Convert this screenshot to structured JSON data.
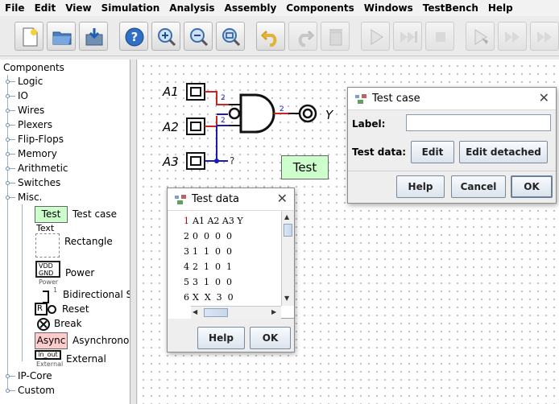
{
  "menu": [
    "File",
    "Edit",
    "View",
    "Simulation",
    "Analysis",
    "Assembly",
    "Components",
    "Windows",
    "TestBench",
    "Help"
  ],
  "toolbar": {
    "icons": [
      "new-file-icon",
      "open-folder-icon",
      "save-icon",
      "help-icon",
      "zoom-in-icon",
      "zoom-out-icon",
      "zoom-fit-icon",
      "undo-icon",
      "redo-icon",
      "delete-icon",
      "run-icon",
      "step-forward-icon",
      "stop-icon",
      "run-tests-icon",
      "test-step-icon",
      "test-run-all-icon"
    ]
  },
  "tree": {
    "root": "Components",
    "groups": [
      "Logic",
      "IO",
      "Wires",
      "Plexers",
      "Flip-Flops",
      "Memory",
      "Arithmetic",
      "Switches",
      "Misc."
    ],
    "misc_items": [
      {
        "label": "Test case",
        "icon_text": "Test"
      },
      {
        "label": "Rectangle",
        "icon_caption": "Text"
      },
      {
        "label": "Power",
        "icon_text_1": "VDD",
        "icon_text_2": "GND",
        "icon_caption": "Power"
      },
      {
        "label": "Bidirectional Sp",
        "icon_caption": "1"
      },
      {
        "label": "Reset",
        "icon_text": "R"
      },
      {
        "label": "Break"
      },
      {
        "label": "Asynchronou",
        "icon_text": "Async"
      },
      {
        "label": "External",
        "icon_text": "in_out",
        "icon_caption": "External"
      }
    ],
    "tail_groups": [
      "IP-Core",
      "Custom"
    ]
  },
  "circuit": {
    "inputs": [
      "A1",
      "A2",
      "A3"
    ],
    "output": "Y",
    "bus_width": "2",
    "unknown_mark": "?",
    "test_label": "Test"
  },
  "test_case_dialog": {
    "title": "Test case",
    "label_field_label": "Label:",
    "label_value": "",
    "test_data_label": "Test data:",
    "edit_button": "Edit",
    "edit_detached_button": "Edit detached",
    "help_button": "Help",
    "cancel_button": "Cancel",
    "ok_button": "OK"
  },
  "test_data_dialog": {
    "title": "Test data",
    "line_numbers": [
      "1",
      "2",
      "3",
      "4",
      "5",
      "6"
    ],
    "lines": [
      "A1 A2 A3 Y",
      "0  0  0  0",
      "1  1  0  0",
      "2  1  0  1",
      "3  1  0  0",
      "X  X  3  0"
    ],
    "help_button": "Help",
    "ok_button": "OK"
  },
  "colors": {
    "wire_blue": "#1a1ab8",
    "wire_red": "#cc2222",
    "test_green": "#ccffcc",
    "async_pink": "#ffcccc",
    "line_number_red": "#cc0000"
  }
}
